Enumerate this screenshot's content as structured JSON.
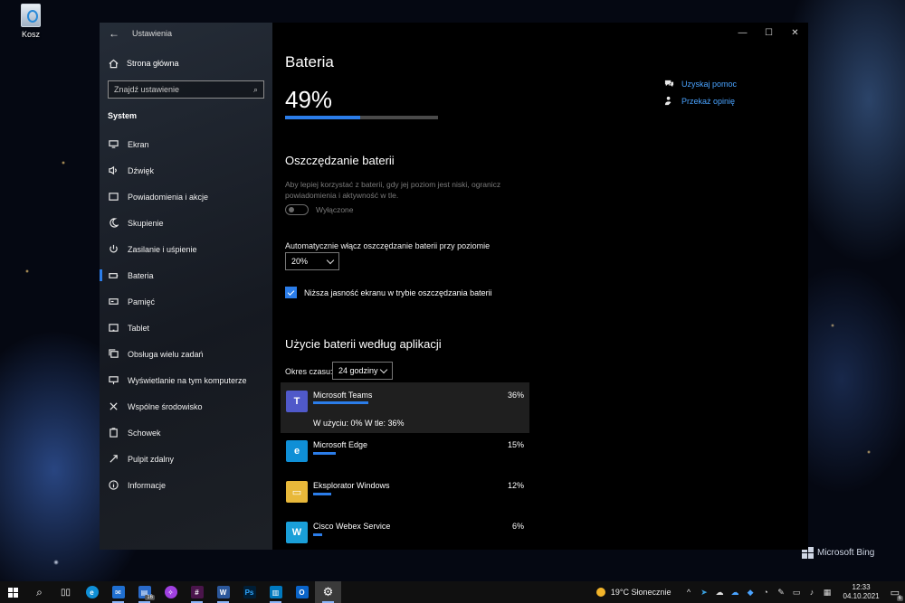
{
  "desktop": {
    "recycle_bin_label": "Kosz",
    "watermark": "Microsoft Bing"
  },
  "window": {
    "title": "Ustawienia",
    "sidebar": {
      "home_label": "Strona główna",
      "search_placeholder": "Znajdź ustawienie",
      "section_title": "System",
      "items": [
        {
          "label": "Ekran",
          "icon": "monitor-icon"
        },
        {
          "label": "Dźwięk",
          "icon": "speaker-icon"
        },
        {
          "label": "Powiadomienia i akcje",
          "icon": "notification-icon"
        },
        {
          "label": "Skupienie",
          "icon": "moon-icon"
        },
        {
          "label": "Zasilanie i uśpienie",
          "icon": "power-icon"
        },
        {
          "label": "Bateria",
          "icon": "battery-icon",
          "active": true
        },
        {
          "label": "Pamięć",
          "icon": "storage-icon"
        },
        {
          "label": "Tablet",
          "icon": "tablet-icon"
        },
        {
          "label": "Obsługa wielu zadań",
          "icon": "multitasking-icon"
        },
        {
          "label": "Wyświetlanie na tym komputerze",
          "icon": "project-icon"
        },
        {
          "label": "Wspólne środowisko",
          "icon": "shared-icon"
        },
        {
          "label": "Schowek",
          "icon": "clipboard-icon"
        },
        {
          "label": "Pulpit zdalny",
          "icon": "remote-desktop-icon"
        },
        {
          "label": "Informacje",
          "icon": "info-icon"
        }
      ]
    },
    "main": {
      "title": "Bateria",
      "battery_percent_label": "49%",
      "battery_level": 0.49,
      "help_links": [
        "Uzyskaj pomoc",
        "Przekaż opinię"
      ],
      "saver": {
        "heading": "Oszczędzanie baterii",
        "description": "Aby lepiej korzystać z baterii, gdy jej poziom jest niski, ogranicz powiadomienia i aktywność w tle.",
        "toggle_state": "Wyłączone",
        "auto_label": "Automatycznie włącz oszczędzanie baterii przy poziomie",
        "auto_value": "20%",
        "checkbox_label": "Niższa jasność ekranu w trybie oszczędzania baterii",
        "checkbox_checked": true
      },
      "usage": {
        "heading": "Użycie baterii według aplikacji",
        "period_label": "Okres czasu:",
        "period_value": "24 godziny",
        "apps": [
          {
            "name": "Microsoft Teams",
            "percent": "36%",
            "usage": 0.36,
            "detail": "W użyciu: 0%  W tle: 36%",
            "color": "#5059c9",
            "icon_letter": "T"
          },
          {
            "name": "Microsoft Edge",
            "percent": "15%",
            "usage": 0.15,
            "color": "#0f8fd6",
            "icon_letter": "e"
          },
          {
            "name": "Eksplorator Windows",
            "percent": "12%",
            "usage": 0.12,
            "color": "#e8b83a",
            "icon_letter": "▭"
          },
          {
            "name": "Cisco Webex Service",
            "percent": "6%",
            "usage": 0.06,
            "color": "#1a9fd8",
            "icon_letter": "W"
          }
        ]
      }
    }
  },
  "taskbar": {
    "weather": "19°C  Słonecznie",
    "time": "12:33",
    "date": "04.10.2021",
    "notifications_count": "6",
    "word_badge": "16"
  }
}
